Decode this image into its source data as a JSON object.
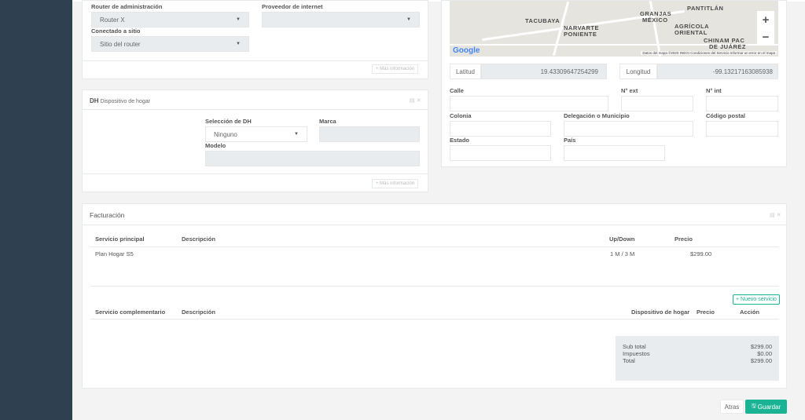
{
  "router_panel": {
    "router_admin_label": "Router de administración",
    "router_admin_value": "Router X",
    "isp_label": "Proveedor de internet",
    "isp_value": "",
    "connected_label": "Conectado a sitio",
    "connected_value": "Sitio del router",
    "more_info": "+ Más información"
  },
  "dh_panel": {
    "title": "DH",
    "subtitle": "Dispositivo de hogar",
    "selection_label": "Selección de DH",
    "selection_value": "Ninguno",
    "brand_label": "Marca",
    "brand_value": "",
    "model_label": "Modelo",
    "model_value": "",
    "more_info": "+ Más información"
  },
  "location_panel": {
    "map": {
      "labels": [
        "TACUBAYA",
        "NARVARTE",
        "PONIENTE",
        "GRANJAS",
        "MÉXICO",
        "AGRÍCOLA",
        "ORIENTAL",
        "CHINAM PAC",
        "DE JUÁREZ",
        "PANTITLÁN"
      ],
      "google": "Google",
      "attribution": "Datos del mapa ©2020 INEGI   Condiciones del Servicio   Informar un error en el mapa",
      "zoom_in": "+",
      "zoom_out": "−"
    },
    "lat_label": "Latitud",
    "lat_value": "19.43309647254299",
    "lng_label": "Longitud",
    "lng_value": "-99.13217163085938",
    "street_label": "Calle",
    "ext_label": "N° ext",
    "int_label": "N° int",
    "colonia_label": "Colonia",
    "delegacion_label": "Delegación o Municipio",
    "cp_label": "Código postal",
    "estado_label": "Estado",
    "pais_label": "País"
  },
  "billing_panel": {
    "title": "Facturación",
    "main_headers": {
      "service": "Servicio principal",
      "description": "Descripción",
      "updown": "Up/Down",
      "price": "Precio"
    },
    "main_row": {
      "service": "Plan Hogar S5",
      "description": "",
      "updown": "1 M / 3 M",
      "price": "$299.00"
    },
    "new_service": "+ Nuevo servicio",
    "comp_headers": {
      "service": "Servicio complementario",
      "description": "Descripción",
      "device": "Dispositivo de hogar",
      "price": "Precio",
      "action": "Acción"
    },
    "totals": {
      "subtotal_label": "Sub total",
      "subtotal_value": "$299.00",
      "tax_label": "Impuestos",
      "tax_value": "$0.00",
      "total_label": "Total",
      "total_value": "$299.00"
    }
  },
  "footer": {
    "back": "Atras",
    "save": "Guardar"
  },
  "colors": {
    "sidebar": "#2f4050",
    "accent": "#1ab394",
    "background": "#f3f3f4"
  }
}
